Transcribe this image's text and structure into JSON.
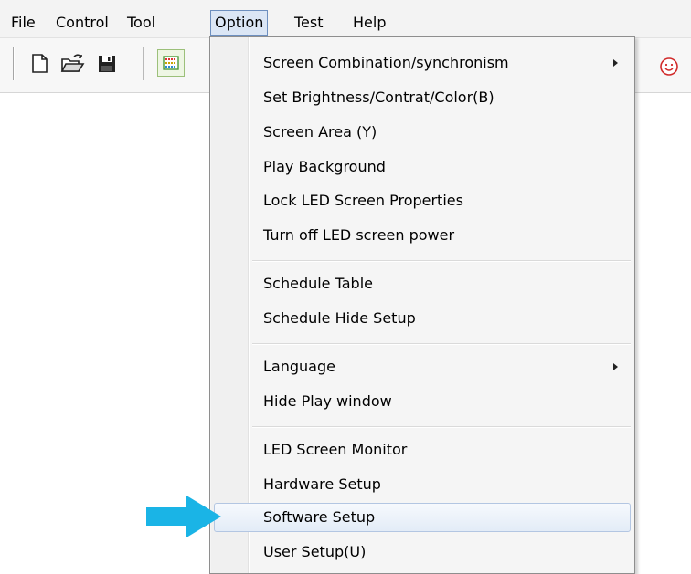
{
  "menubar": {
    "items": [
      {
        "label": "File"
      },
      {
        "label": "Control"
      },
      {
        "label": "Tool"
      },
      {
        "label": "Option"
      },
      {
        "label": "Test"
      },
      {
        "label": "Help"
      }
    ]
  },
  "toolbar": {
    "buttons": [
      {
        "icon": "new-document-icon"
      },
      {
        "icon": "open-folder-icon"
      },
      {
        "icon": "save-disk-icon"
      },
      {
        "icon": "led-screen-icon"
      }
    ],
    "right_icon": "smiley-icon"
  },
  "option_menu": {
    "items": [
      {
        "label": "Screen Combination/synchronism",
        "submenu": true
      },
      {
        "label": "Set Brightness/Contrat/Color(B)"
      },
      {
        "label": "Screen Area (Y)"
      },
      {
        "label": "Play Background"
      },
      {
        "label": "Lock LED Screen Properties"
      },
      {
        "label": "Turn off LED screen power"
      },
      {
        "label": "Schedule Table"
      },
      {
        "label": "Schedule Hide Setup"
      },
      {
        "label": "Language",
        "submenu": true
      },
      {
        "label": "Hide Play window"
      },
      {
        "label": "LED Screen Monitor"
      },
      {
        "label": "Hardware Setup"
      },
      {
        "label": "Software Setup",
        "highlighted": true
      },
      {
        "label": "User Setup(U)"
      }
    ]
  },
  "annotation": {
    "arrow_color": "#1ab4e6"
  },
  "colors": {
    "menu_active_border": "#6d8fbf",
    "menu_hover_border": "#b3c6e2",
    "menu_background": "#f5f5f5"
  }
}
